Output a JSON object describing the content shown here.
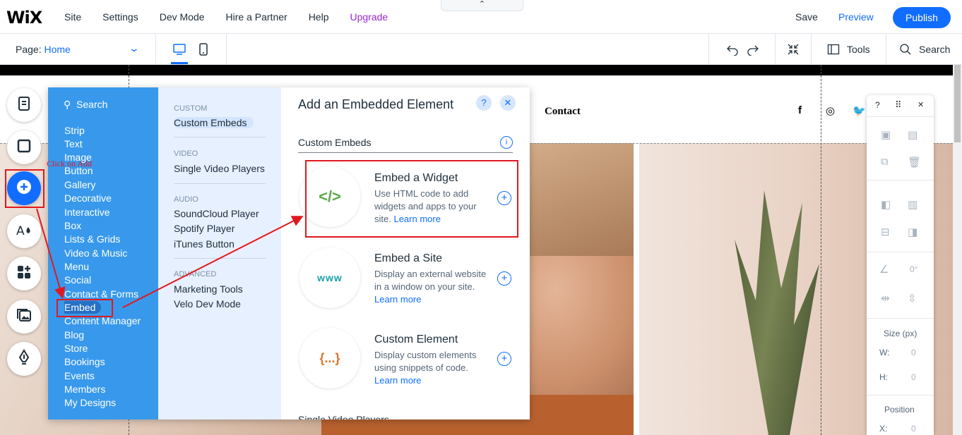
{
  "topbar": {
    "logo": "WiX",
    "menu": [
      "Site",
      "Settings",
      "Dev Mode",
      "Hire a Partner",
      "Help",
      "Upgrade"
    ],
    "collapse_glyph": "⌃",
    "save": "Save",
    "preview": "Preview",
    "publish": "Publish"
  },
  "subbar": {
    "page_label": "Page: ",
    "page_value": "Home",
    "tools": "Tools",
    "search": "Search"
  },
  "site": {
    "contact": "Contact",
    "social": [
      "f",
      "◎",
      "🐦"
    ]
  },
  "annotation": {
    "click_text": "Click on Add"
  },
  "add_panel": {
    "search": "Search",
    "categories": [
      "Strip",
      "Text",
      "Image",
      "Button",
      "Gallery",
      "Decorative",
      "Interactive",
      "Box",
      "Lists & Grids",
      "Video & Music",
      "Menu",
      "Social",
      "Contact & Forms",
      "Embed",
      "Content Manager",
      "Blog",
      "Store",
      "Bookings",
      "Events",
      "Members",
      "My Designs"
    ],
    "selected_category": "Embed",
    "sub_sections": [
      {
        "heading": "CUSTOM",
        "items": [
          "Custom Embeds"
        ]
      },
      {
        "heading": "VIDEO",
        "items": [
          "Single Video Players"
        ]
      },
      {
        "heading": "AUDIO",
        "items": [
          "SoundCloud Player",
          "Spotify Player",
          "iTunes Button"
        ]
      },
      {
        "heading": "ADVANCED",
        "items": [
          "Marketing Tools",
          "Velo Dev Mode"
        ]
      }
    ],
    "title": "Add an Embedded Element",
    "help": "?",
    "close": "✕",
    "section_title": "Custom Embeds",
    "info": "i",
    "cards": [
      {
        "icon_text": "</>",
        "title": "Embed a Widget",
        "desc": "Use HTML code to add widgets and apps to your site. ",
        "link": "Learn more"
      },
      {
        "icon_text": "www",
        "title": "Embed a Site",
        "desc": "Display an external website in a window on your site. ",
        "link": "Learn more"
      },
      {
        "icon_text": "{...}",
        "title": "Custom Element",
        "desc": "Display custom elements using snippets of code. ",
        "link": "Learn more"
      }
    ],
    "add_glyph": "+",
    "next_section": "Single Video Players"
  },
  "right_panel": {
    "help": "?",
    "drag": "⠿",
    "close": "✕",
    "rotation": "0°",
    "size_label": "Size (px)",
    "w_label": "W:",
    "w_value": "0",
    "h_label": "H:",
    "h_value": "0",
    "position_label": "Position",
    "x_label": "X:",
    "x_value": "0"
  },
  "colors": {
    "accent": "#116dff",
    "panel_blue": "#3899ec",
    "annotation_red": "#e0191e",
    "upgrade": "#9a27d5"
  },
  "icons": [
    "pages-icon",
    "background-icon",
    "add-icon",
    "theme-icon",
    "app-market-icon",
    "media-icon",
    "blog-pen-icon",
    "desktop-icon",
    "mobile-icon",
    "undo-icon",
    "redo-icon",
    "zoom-out-icon",
    "tools-icon",
    "search-icon"
  ]
}
